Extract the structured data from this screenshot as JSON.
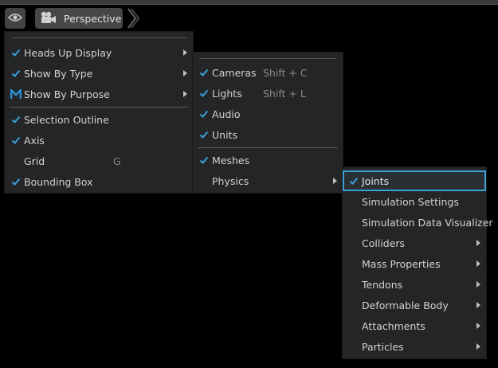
{
  "toolbar": {
    "eye_icon": "eye-icon",
    "camera_icon": "camera-icon",
    "perspective_label": "Perspective"
  },
  "menu_main": {
    "items": [
      {
        "label": "Heads Up Display",
        "checked": true,
        "submenu": true
      },
      {
        "label": "Show By Type",
        "checked": true,
        "submenu": true
      },
      {
        "label": "Show By Purpose",
        "icon": "purpose-m-icon",
        "submenu": true
      },
      {
        "label": "Selection Outline",
        "checked": true
      },
      {
        "label": "Axis",
        "checked": true
      },
      {
        "label": "Grid",
        "shortcut": "G"
      },
      {
        "label": "Bounding Box",
        "checked": true
      }
    ]
  },
  "menu_type": {
    "items": [
      {
        "label": "Cameras",
        "checked": true,
        "shortcut": "Shift + C"
      },
      {
        "label": "Lights",
        "checked": true,
        "shortcut": "Shift + L"
      },
      {
        "label": "Audio",
        "checked": true
      },
      {
        "label": "Units",
        "checked": true
      },
      {
        "label": "Meshes",
        "checked": true
      },
      {
        "label": "Physics",
        "submenu": true
      }
    ]
  },
  "menu_physics": {
    "items": [
      {
        "label": "Joints",
        "checked": true,
        "highlighted": true
      },
      {
        "label": "Simulation Settings"
      },
      {
        "label": "Simulation Data Visualizer"
      },
      {
        "label": "Colliders",
        "submenu": true
      },
      {
        "label": "Mass Properties",
        "submenu": true
      },
      {
        "label": "Tendons",
        "submenu": true
      },
      {
        "label": "Deformable Body",
        "submenu": true
      },
      {
        "label": "Attachments",
        "submenu": true
      },
      {
        "label": "Particles",
        "submenu": true
      }
    ]
  },
  "colors": {
    "accent": "#3aa0d8",
    "menu_bg": "#232527",
    "text": "#d2d2d2",
    "shortcut_text": "#8a8a8a"
  }
}
